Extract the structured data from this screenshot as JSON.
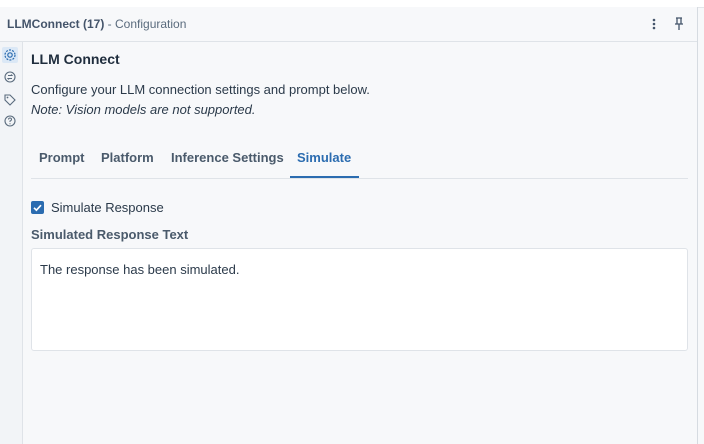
{
  "window": {
    "title_tool": "LLMConnect (17)",
    "title_suffix": " - Configuration"
  },
  "icons": {
    "more": "kebab-menu-icon",
    "pin": "pin-icon",
    "rail": [
      "gear-icon",
      "swap-icon",
      "tag-icon",
      "help-icon"
    ]
  },
  "panel": {
    "heading": "LLM Connect",
    "description": "Configure your LLM connection settings and prompt below.",
    "note": "Note: Vision models are not supported."
  },
  "tabs": [
    {
      "label": "Prompt"
    },
    {
      "label": "Platform"
    },
    {
      "label": "Inference Settings"
    },
    {
      "label": "Simulate",
      "active": true
    }
  ],
  "simulate": {
    "checkbox_label": "Simulate Response",
    "checked": true,
    "text_label": "Simulated Response Text",
    "text_value": "The response has been simulated."
  },
  "colors": {
    "accent": "#2b6cb0",
    "background": "#f7f8fa"
  }
}
